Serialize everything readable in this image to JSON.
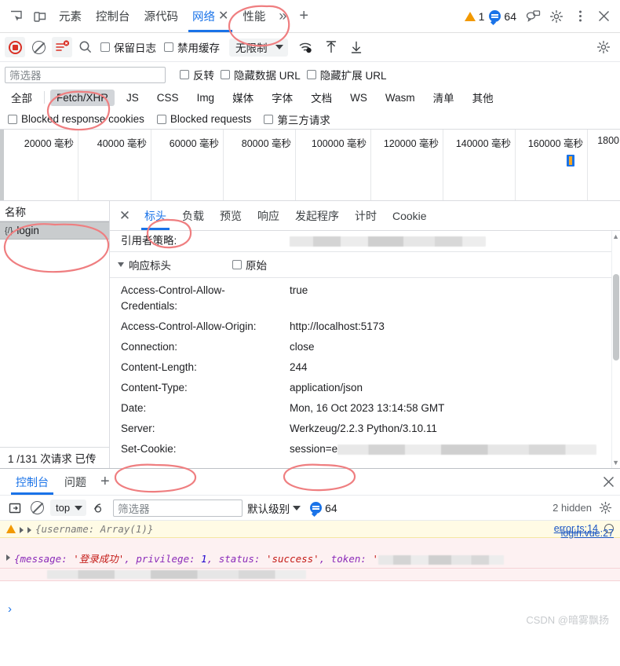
{
  "main_tabs": {
    "inspect_icon": "inspect-element-icon",
    "device_icon": "device-toolbar-icon",
    "items": [
      {
        "label": "元素",
        "active": false
      },
      {
        "label": "控制台",
        "active": false
      },
      {
        "label": "源代码",
        "active": false
      },
      {
        "label": "网络",
        "active": true,
        "closable": true
      },
      {
        "label": "性能",
        "active": false
      }
    ],
    "more_label": "»",
    "add_label": "+",
    "warning_count": "1",
    "message_count": "64",
    "feedback_icon": "feedback-icon",
    "settings_icon": "gear-icon",
    "kebab_icon": "more-vertical-icon",
    "close_icon": "close-icon"
  },
  "network_toolbar": {
    "record_icon": "record-stop-icon",
    "clear_icon": "clear-network-icon",
    "filter_icon": "filter-clear-icon",
    "search_icon": "search-icon",
    "preserve_log": "保留日志",
    "disable_cache": "禁用缓存",
    "throttle_value": "无限制",
    "wifi_icon": "network-conditions-icon",
    "import_icon": "import-har-icon",
    "export_icon": "export-har-icon",
    "settings_icon": "gear-icon"
  },
  "filter_bar": {
    "placeholder": "筛选器",
    "invert": "反转",
    "hide_data_urls": "隐藏数据 URL",
    "hide_ext_urls": "隐藏扩展 URL"
  },
  "type_chips": [
    {
      "label": "全部",
      "selected": false
    },
    {
      "label": "Fetch/XHR",
      "selected": true
    },
    {
      "label": "JS",
      "selected": false
    },
    {
      "label": "CSS",
      "selected": false
    },
    {
      "label": "Img",
      "selected": false
    },
    {
      "label": "媒体",
      "selected": false
    },
    {
      "label": "字体",
      "selected": false
    },
    {
      "label": "文档",
      "selected": false
    },
    {
      "label": "WS",
      "selected": false
    },
    {
      "label": "Wasm",
      "selected": false
    },
    {
      "label": "清单",
      "selected": false
    },
    {
      "label": "其他",
      "selected": false
    }
  ],
  "blocked_row": {
    "blocked_response_cookies": "Blocked response cookies",
    "blocked_requests": "Blocked requests",
    "third_party": "第三方请求"
  },
  "timeline": {
    "unit": "毫秒",
    "ticks": [
      "20000 毫秒",
      "40000 毫秒",
      "60000 毫秒",
      "80000 毫秒",
      "100000 毫秒",
      "120000 毫秒",
      "140000 毫秒",
      "160000 毫秒",
      "1800"
    ]
  },
  "request_list": {
    "header": "名称",
    "items": [
      {
        "name": "login",
        "icon": "json-icon",
        "selected": true
      }
    ],
    "status": "1 /131 次请求  已传"
  },
  "details": {
    "close_icon": "close-icon",
    "tabs": [
      {
        "label": "标头",
        "active": true
      },
      {
        "label": "负载",
        "active": false
      },
      {
        "label": "预览",
        "active": false
      },
      {
        "label": "响应",
        "active": false
      },
      {
        "label": "发起程序",
        "active": false
      },
      {
        "label": "计时",
        "active": false
      },
      {
        "label": "Cookie",
        "active": false
      }
    ],
    "referrer_policy_label": "引用者策略:",
    "referrer_policy_value": "",
    "section_title": "响应标头",
    "raw_label": "原始",
    "headers": [
      {
        "name": "Access-Control-Allow-Credentials:",
        "value": "true",
        "wrap": true
      },
      {
        "name": "Access-Control-Allow-Origin:",
        "value": "http://localhost:5173"
      },
      {
        "name": "Connection:",
        "value": "close"
      },
      {
        "name": "Content-Length:",
        "value": "244"
      },
      {
        "name": "Content-Type:",
        "value": "application/json"
      },
      {
        "name": "Date:",
        "value": "Mon, 16 Oct 2023 13:14:58 GMT"
      },
      {
        "name": "Server:",
        "value": "Werkzeug/2.2.3 Python/3.10.11"
      },
      {
        "name": "Set-Cookie:",
        "value": "session=e",
        "redacted": true
      }
    ]
  },
  "drawer": {
    "tabs": [
      {
        "label": "控制台",
        "active": true
      },
      {
        "label": "问题",
        "active": false
      }
    ],
    "add_label": "+",
    "close_icon": "close-icon",
    "console_toolbar": {
      "sidebar_icon": "console-sidebar-icon",
      "clear_icon": "clear-console-icon",
      "context": "top",
      "eye_icon": "live-expression-icon",
      "filter_placeholder": "筛选器",
      "level": "默认级别",
      "message_count": "64",
      "hidden_text": "2 hidden",
      "settings_icon": "gear-icon"
    },
    "messages": [
      {
        "type": "warning",
        "text": "{username: Array(1)}",
        "source": "error.ts:14"
      },
      {
        "type": "error",
        "prefix": "{message: ",
        "str1": "'登录成功'",
        "mid1": ", privilege: ",
        "num1": "1",
        "mid2": ", status: ",
        "str2": "'success'",
        "mid3": ", token: ",
        "source": "login.vue:27"
      }
    ],
    "prompt": "›"
  },
  "watermark": "CSDN @暗雾飘扬",
  "colors": {
    "accent": "#1a73e8",
    "record": "#d93025",
    "warning": "#f29900",
    "annotation": "#ef7e80"
  }
}
